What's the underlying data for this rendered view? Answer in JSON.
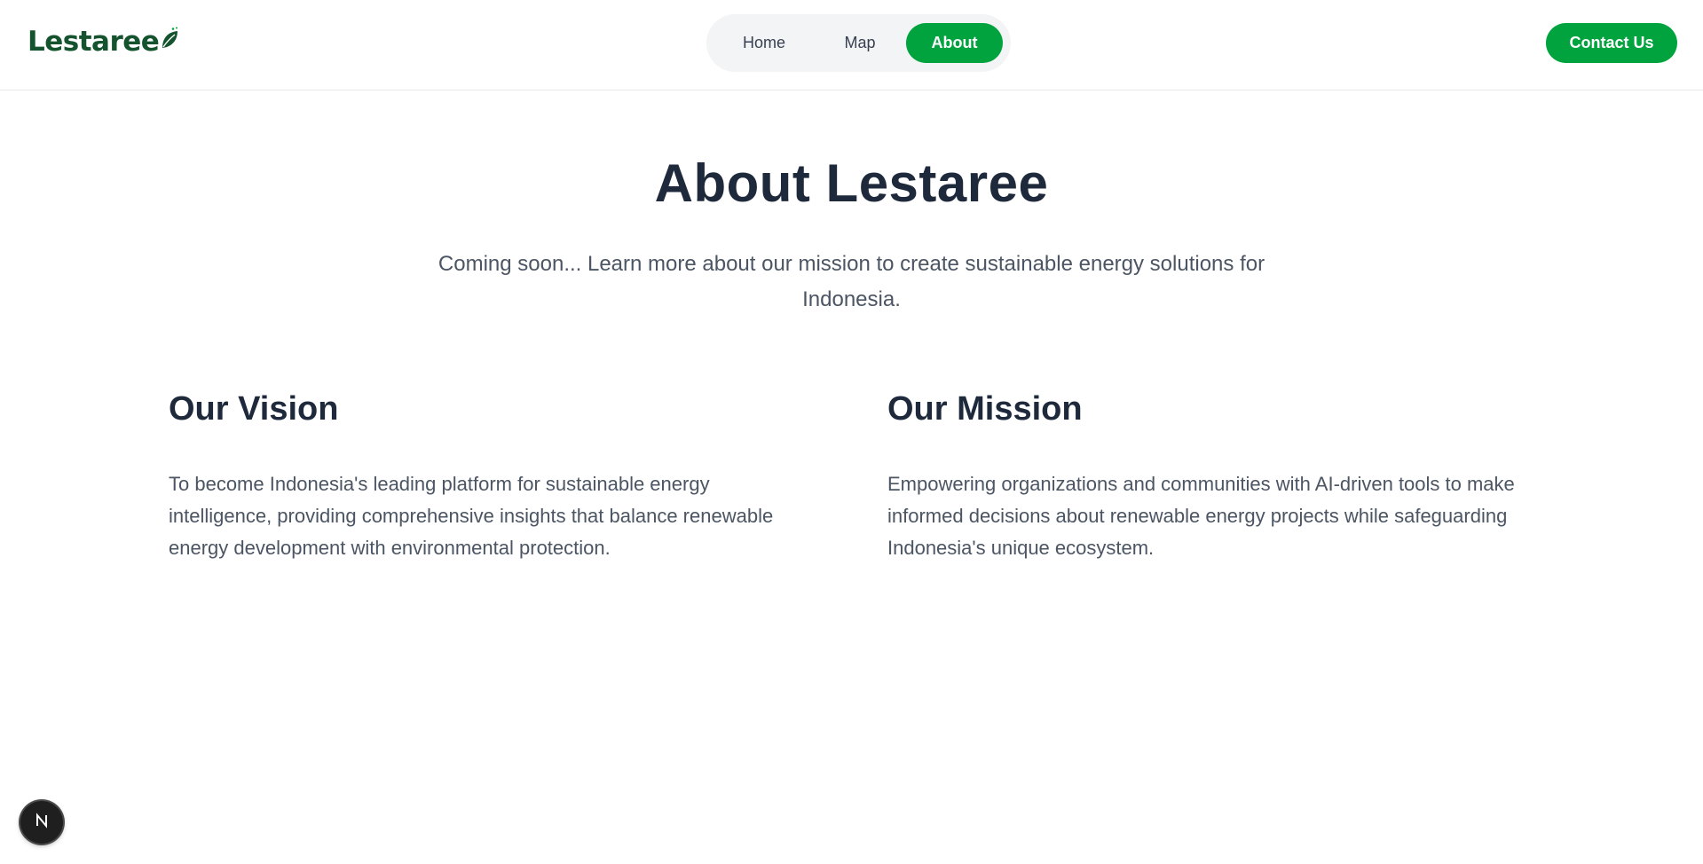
{
  "header": {
    "logo_text": "Lestaree",
    "nav": {
      "home": "Home",
      "map": "Map",
      "about": "About"
    },
    "contact_label": "Contact Us"
  },
  "main": {
    "title": "About Lestaree",
    "subtitle": "Coming soon... Learn more about our mission to create sustainable energy solutions for Indonesia.",
    "vision": {
      "heading": "Our Vision",
      "body": "To become Indonesia's leading platform for sustainable energy intelligence, providing comprehensive insights that balance renewable energy development with environmental protection."
    },
    "mission": {
      "heading": "Our Mission",
      "body": "Empowering organizations and communities with AI-driven tools to make informed decisions about renewable energy projects while safeguarding Indonesia's unique ecosystem."
    }
  },
  "badge": {
    "icon": "nextjs-icon"
  },
  "colors": {
    "brand_green": "#00a33d",
    "logo_green": "#14532d",
    "heading": "#1e293b",
    "body_text": "#4b5563"
  }
}
